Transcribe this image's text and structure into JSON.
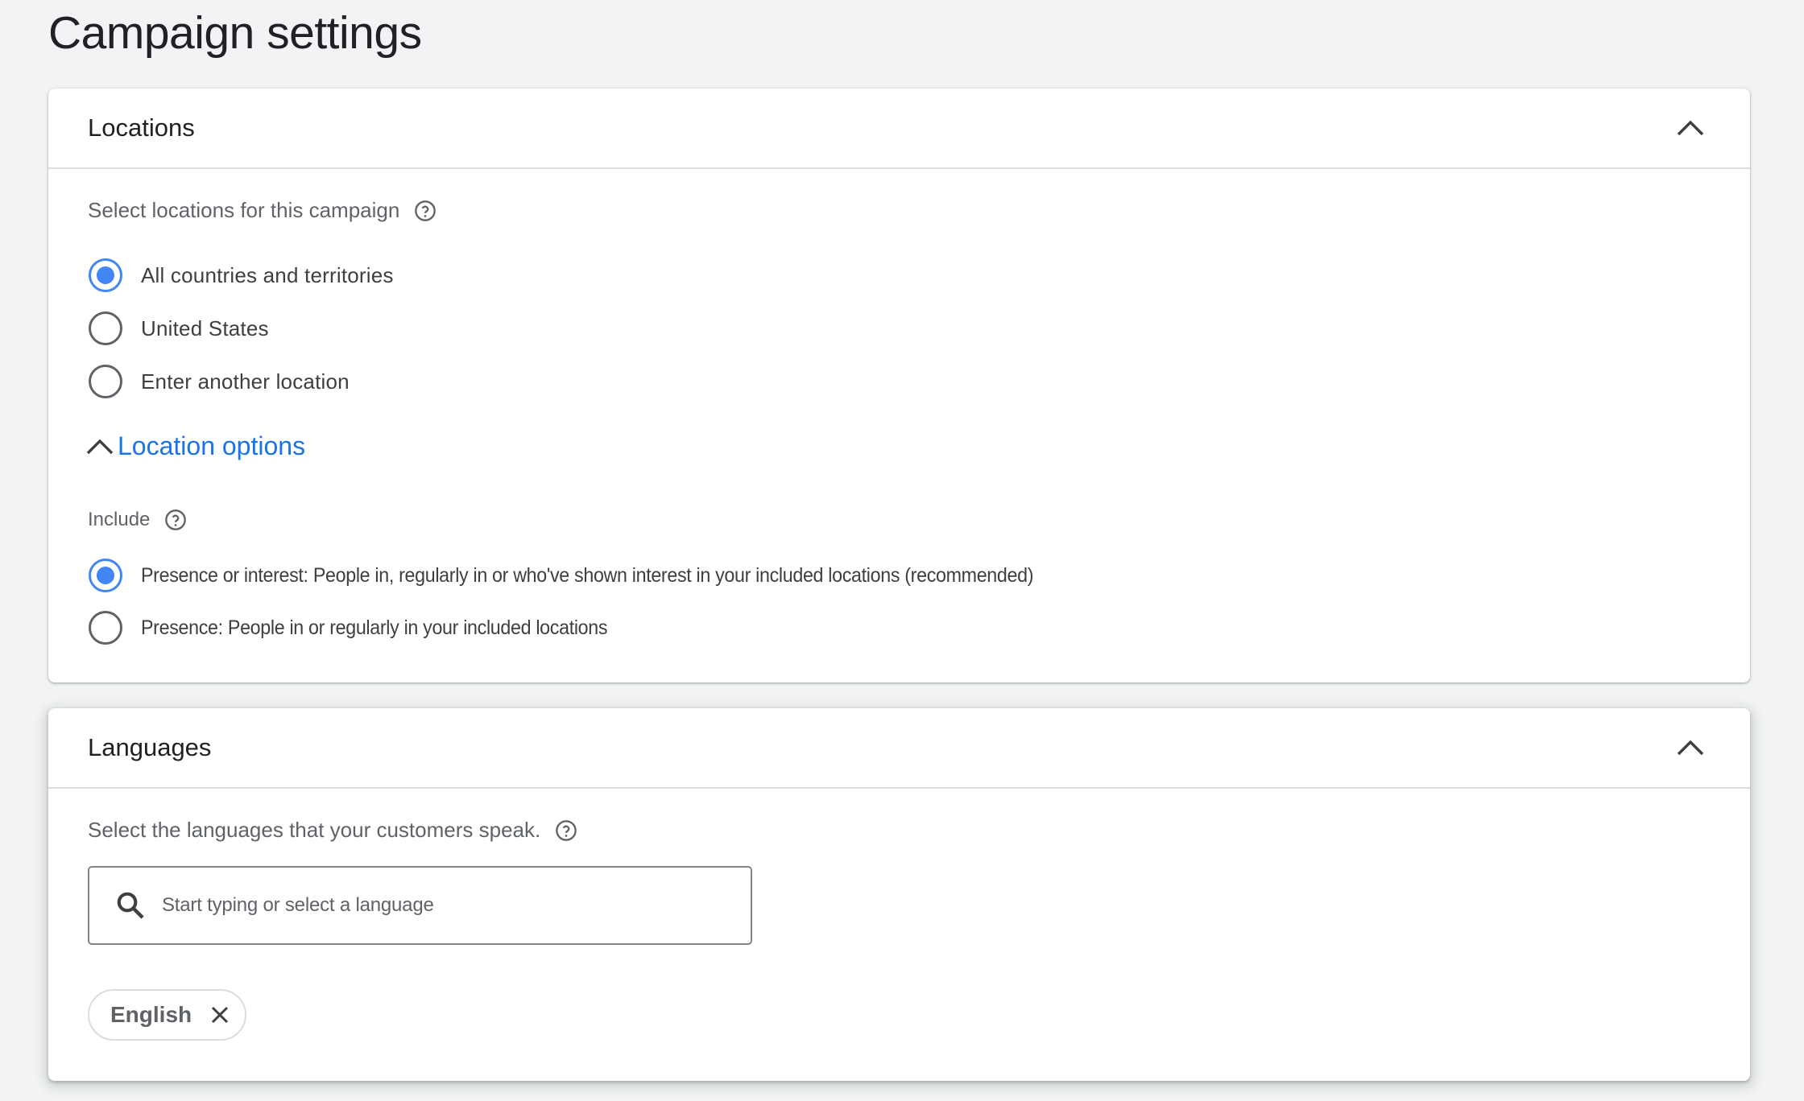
{
  "page": {
    "title": "Campaign settings"
  },
  "locations": {
    "title": "Locations",
    "collapse_icon": "chevron-up-icon",
    "prompt": "Select locations for this campaign",
    "options": [
      {
        "label": "All countries and territories",
        "selected": true
      },
      {
        "label": "United States",
        "selected": false
      },
      {
        "label": "Enter another location",
        "selected": false
      }
    ],
    "location_options": {
      "label": "Location options",
      "expanded": true,
      "include_label": "Include",
      "include_options": [
        {
          "label": "Presence or interest: People in, regularly in or who've shown interest in your included locations (recommended)",
          "selected": true
        },
        {
          "label": "Presence: People in or regularly in your included locations",
          "selected": false
        }
      ]
    }
  },
  "languages": {
    "title": "Languages",
    "collapse_icon": "chevron-up-icon",
    "prompt": "Select the languages that your customers speak.",
    "search": {
      "placeholder": "Start typing or select a language",
      "value": ""
    },
    "selected": [
      {
        "label": "English"
      }
    ]
  },
  "colors": {
    "accent": "#1a73e8",
    "radio_selected": "#4285f4",
    "background": "#f1f3f4"
  }
}
